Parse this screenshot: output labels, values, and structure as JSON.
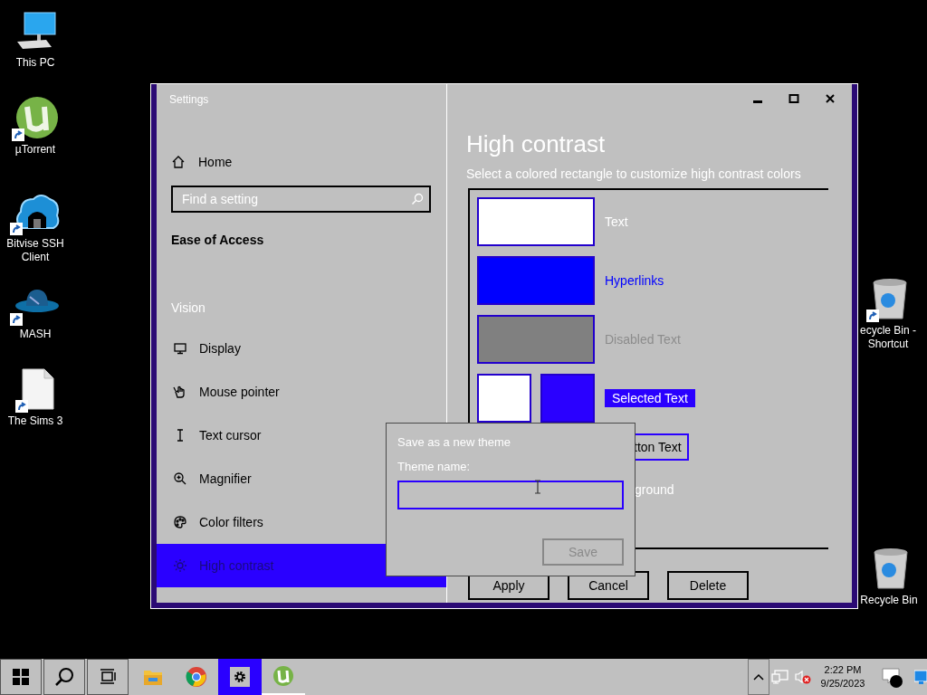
{
  "desktop_icons": [
    {
      "kind": "computer",
      "label": "This PC",
      "shortcut": false
    },
    {
      "kind": "torrent",
      "label": "µTorrent",
      "shortcut": true
    },
    {
      "kind": "cloud",
      "label": "Bitvise SSH Client",
      "shortcut": true
    },
    {
      "kind": "hat",
      "label": "MASH",
      "shortcut": true
    },
    {
      "kind": "document",
      "label": "The Sims 3",
      "shortcut": true
    },
    {
      "kind": "bin",
      "label": "ecycle Bin - Shortcut",
      "shortcut": true
    },
    {
      "kind": "bin",
      "label": "Recycle Bin",
      "shortcut": false
    }
  ],
  "window": {
    "title": "Settings",
    "sidebar": {
      "home": "Home",
      "search": {
        "placeholder": "Find a setting"
      },
      "section": "Ease of Access",
      "group": "Vision",
      "items": [
        {
          "kind": "display",
          "label": "Display",
          "selected": false
        },
        {
          "kind": "pointer",
          "label": "Mouse pointer",
          "selected": false
        },
        {
          "kind": "cursor",
          "label": "Text cursor",
          "selected": false
        },
        {
          "kind": "magnifier",
          "label": "Magnifier",
          "selected": false
        },
        {
          "kind": "palette",
          "label": "Color filters",
          "selected": false
        },
        {
          "kind": "contrast",
          "label": "High contrast",
          "selected": true
        }
      ]
    },
    "page": {
      "title": "High contrast",
      "subtitle": "Select a colored rectangle to customize high contrast colors",
      "colors": [
        {
          "kind": "single",
          "label": "Text",
          "color": "#ffffff"
        },
        {
          "kind": "single",
          "label": "Hyperlinks",
          "color": "#0000ff"
        },
        {
          "kind": "single",
          "label": "Disabled Text",
          "color": "#808080"
        },
        {
          "kind": "pair",
          "label": "Selected Text",
          "swatches": [
            {
              "color": "#ffffff"
            },
            {
              "color": "#2a00ff"
            }
          ]
        },
        {
          "kind": "button",
          "label": "tton Text"
        },
        {
          "kind": "plain",
          "label": "ground"
        }
      ],
      "buttons": [
        "Apply",
        "Cancel",
        "Delete"
      ]
    },
    "dialog": {
      "title": "Save as a new theme",
      "label": "Theme name:",
      "save": {
        "label": "Save",
        "disabled": true
      }
    }
  },
  "taskbar": {
    "apps": [
      {
        "kind": "folder",
        "selected": false,
        "running": false
      },
      {
        "kind": "browser",
        "selected": false,
        "running": false
      },
      {
        "kind": "gear",
        "selected": true,
        "running": false
      },
      {
        "kind": "torrent",
        "selected": false,
        "running": true
      }
    ],
    "time": "2:22 PM",
    "date": "9/25/2023"
  }
}
